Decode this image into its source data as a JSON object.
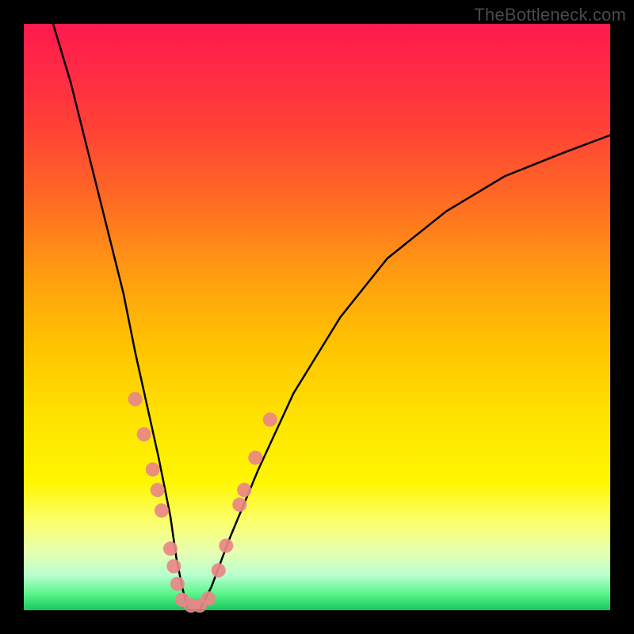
{
  "watermark": "TheBottleneck.com",
  "chart_data": {
    "type": "line",
    "title": "",
    "xlabel": "",
    "ylabel": "",
    "xlim": [
      0,
      100
    ],
    "ylim": [
      0,
      100
    ],
    "grid": false,
    "series": [
      {
        "name": "bottleneck-curve",
        "color": "#000000",
        "x": [
          5,
          8,
          11,
          14,
          17,
          19,
          21,
          23,
          25,
          26,
          27,
          28,
          30,
          32,
          35,
          40,
          46,
          54,
          62,
          72,
          82,
          92,
          100
        ],
        "y": [
          100,
          90,
          78,
          66,
          54,
          44,
          35,
          26,
          16,
          9,
          4,
          0,
          0,
          4,
          12,
          24,
          37,
          50,
          60,
          68,
          74,
          78,
          81
        ]
      }
    ],
    "markers": {
      "name": "data-points",
      "color": "#e98787",
      "points": [
        {
          "x": 19.0,
          "y": 36.0
        },
        {
          "x": 20.5,
          "y": 30.0
        },
        {
          "x": 22.0,
          "y": 24.0
        },
        {
          "x": 22.8,
          "y": 20.5
        },
        {
          "x": 23.5,
          "y": 17.0
        },
        {
          "x": 25.0,
          "y": 10.5
        },
        {
          "x": 25.6,
          "y": 7.5
        },
        {
          "x": 26.2,
          "y": 4.5
        },
        {
          "x": 27.0,
          "y": 1.8
        },
        {
          "x": 28.5,
          "y": 0.8
        },
        {
          "x": 30.0,
          "y": 0.8
        },
        {
          "x": 31.5,
          "y": 2.0
        },
        {
          "x": 33.2,
          "y": 6.8
        },
        {
          "x": 34.5,
          "y": 11.0
        },
        {
          "x": 36.8,
          "y": 18.0
        },
        {
          "x": 37.6,
          "y": 20.5
        },
        {
          "x": 39.5,
          "y": 26.0
        },
        {
          "x": 42.0,
          "y": 32.5
        }
      ]
    }
  }
}
